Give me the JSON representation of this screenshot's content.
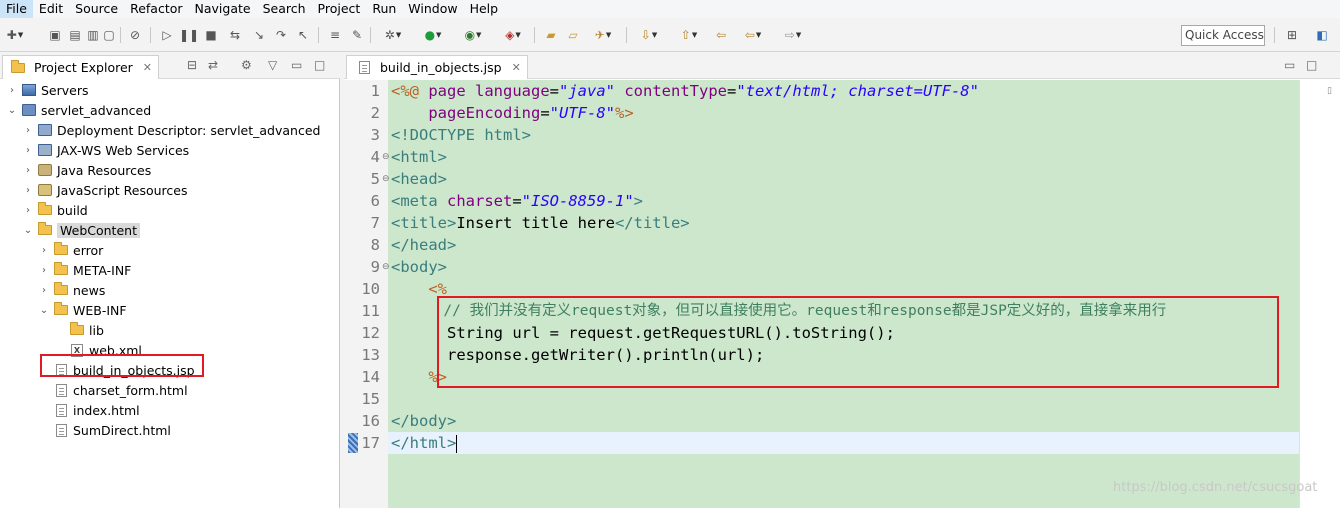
{
  "menu": [
    "File",
    "Edit",
    "Source",
    "Refactor",
    "Navigate",
    "Search",
    "Project",
    "Run",
    "Window",
    "Help"
  ],
  "toolbar": {
    "quick_access": "Quick Access"
  },
  "project_explorer": {
    "tab_label": "Project Explorer",
    "tree": [
      {
        "label": "Servers",
        "icon": "servers-icon",
        "depth": 0,
        "expanded": false
      },
      {
        "label": "servlet_advanced",
        "icon": "project-icon",
        "depth": 0,
        "expanded": true
      },
      {
        "label": "Deployment Descriptor: servlet_advanced",
        "icon": "deployment-descriptor-icon",
        "depth": 1,
        "expanded": false
      },
      {
        "label": "JAX-WS Web Services",
        "icon": "web-services-icon",
        "depth": 1,
        "expanded": false
      },
      {
        "label": "Java Resources",
        "icon": "java-resources-icon",
        "depth": 1,
        "expanded": false
      },
      {
        "label": "JavaScript Resources",
        "icon": "javascript-resources-icon",
        "depth": 1,
        "expanded": false
      },
      {
        "label": "build",
        "icon": "folder-icon",
        "depth": 1,
        "expanded": false
      },
      {
        "label": "WebContent",
        "icon": "folder-open-icon",
        "depth": 1,
        "expanded": true,
        "selected": true
      },
      {
        "label": "error",
        "icon": "folder-icon",
        "depth": 2,
        "expanded": false
      },
      {
        "label": "META-INF",
        "icon": "folder-icon",
        "depth": 2,
        "expanded": false
      },
      {
        "label": "news",
        "icon": "folder-icon",
        "depth": 2,
        "expanded": false
      },
      {
        "label": "WEB-INF",
        "icon": "folder-open-icon",
        "depth": 2,
        "expanded": true
      },
      {
        "label": "lib",
        "icon": "folder-icon",
        "depth": 3
      },
      {
        "label": "web.xml",
        "icon": "xml-file-icon",
        "depth": 3
      },
      {
        "label": "build_in_objects.jsp",
        "icon": "jsp-file-icon",
        "depth": 2,
        "highlighted": true
      },
      {
        "label": "charset_form.html",
        "icon": "html-file-icon",
        "depth": 2
      },
      {
        "label": "index.html",
        "icon": "html-file-icon",
        "depth": 2
      },
      {
        "label": "SumDirect.html",
        "icon": "html-file-icon",
        "depth": 2
      }
    ]
  },
  "editor": {
    "tab_label": "build_in_objects.jsp",
    "lines": [
      {
        "n": "1",
        "fold": ""
      },
      {
        "n": "2",
        "fold": ""
      },
      {
        "n": "3",
        "fold": ""
      },
      {
        "n": "4",
        "fold": "⊖"
      },
      {
        "n": "5",
        "fold": "⊖"
      },
      {
        "n": "6",
        "fold": ""
      },
      {
        "n": "7",
        "fold": ""
      },
      {
        "n": "8",
        "fold": ""
      },
      {
        "n": "9",
        "fold": "⊖"
      },
      {
        "n": "10",
        "fold": ""
      },
      {
        "n": "11",
        "fold": ""
      },
      {
        "n": "12",
        "fold": ""
      },
      {
        "n": "13",
        "fold": ""
      },
      {
        "n": "14",
        "fold": ""
      },
      {
        "n": "15",
        "fold": ""
      },
      {
        "n": "16",
        "fold": ""
      },
      {
        "n": "17",
        "fold": ""
      }
    ],
    "code": {
      "l1_open": "<%@",
      "l1_page": " page ",
      "l1_lang_attr": "language",
      "l1_eq": "=",
      "l1_lang_val": "\"java\"",
      "l1_ct_attr": " contentType",
      "l1_ct_val": "\"text/html; charset=UTF-8\"",
      "l2_indent": "    ",
      "l2_pe_attr": "pageEncoding",
      "l2_pe_val": "\"UTF-8\"",
      "l2_close": "%>",
      "l3": "<!DOCTYPE html>",
      "l4": "<html>",
      "l5": "<head>",
      "l6_tag": "<meta",
      "l6_attr": " charset",
      "l6_val": "\"ISO-8859-1\"",
      "l6_close": ">",
      "l7_open": "<title>",
      "l7_text": "Insert title here",
      "l7_close": "</title>",
      "l8": "</head>",
      "l9": "<body>",
      "l10": "    <%",
      "l11": "      // 我们并没有定义request对象，但可以直接使用它。request和response都是JSP定义好的，直接拿来用行",
      "l12": "      String url = request.getRequestURL().toString();",
      "l13": "      response.getWriter().println(url);",
      "l14": "    %>",
      "l15": "",
      "l16": "</body>",
      "l17": "</html>"
    }
  },
  "watermark": "https://blog.csdn.net/csucsgoat",
  "colors": {
    "code_background": "#cde7cd",
    "annotation_box": "#e01b24",
    "jsp_directive": "#b86428",
    "tag": "#3a7d7d",
    "attribute": "#7f007f",
    "string_value": "#2a00ff",
    "comment": "#3f7f5f"
  }
}
